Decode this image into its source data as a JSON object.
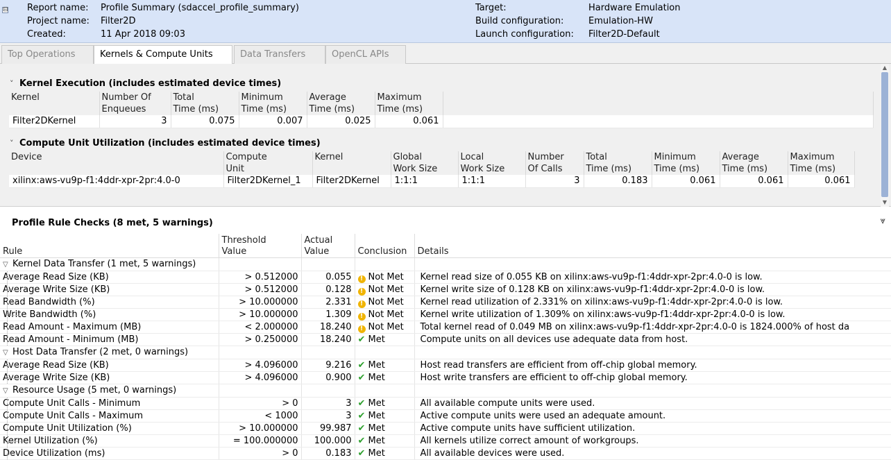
{
  "header": {
    "report_name_label": "Report name:",
    "report_name": "Profile Summary (sdaccel_profile_summary)",
    "project_name_label": "Project name:",
    "project_name": "Filter2D",
    "created_label": "Created:",
    "created": "11 Apr 2018 09:03",
    "target_label": "Target:",
    "target": "Hardware Emulation",
    "build_config_label": "Build configuration:",
    "build_config": "Emulation-HW",
    "launch_config_label": "Launch configuration:",
    "launch_config": "Filter2D-Default",
    "collapse_glyph": "⊟"
  },
  "tabs": [
    {
      "label": "Top Operations",
      "active": false
    },
    {
      "label": "Kernels & Compute Units",
      "active": true
    },
    {
      "label": "Data Transfers",
      "active": false
    },
    {
      "label": "OpenCL APIs",
      "active": false
    }
  ],
  "kernel_execution": {
    "title": "Kernel Execution (includes estimated device times)",
    "headers": [
      [
        "Kernel",
        ""
      ],
      [
        "Number Of",
        "Enqueues"
      ],
      [
        "Total",
        "Time (ms)"
      ],
      [
        "Minimum",
        "Time (ms)"
      ],
      [
        "Average",
        "Time (ms)"
      ],
      [
        "Maximum",
        "Time (ms)"
      ]
    ],
    "rows": [
      [
        "Filter2DKernel",
        "3",
        "0.075",
        "0.007",
        "0.025",
        "0.061"
      ]
    ]
  },
  "compute_unit": {
    "title": "Compute Unit Utilization (includes estimated device times)",
    "headers": [
      [
        "Device",
        ""
      ],
      [
        "Compute",
        "Unit"
      ],
      [
        "Kernel",
        ""
      ],
      [
        "Global",
        "Work Size"
      ],
      [
        "Local",
        "Work Size"
      ],
      [
        "Number",
        "Of Calls"
      ],
      [
        "Total",
        "Time (ms)"
      ],
      [
        "Minimum",
        "Time (ms)"
      ],
      [
        "Average",
        "Time (ms)"
      ],
      [
        "Maximum",
        "Time (ms)"
      ]
    ],
    "rows": [
      [
        "xilinx:aws-vu9p-f1:4ddr-xpr-2pr:4.0-0",
        "Filter2DKernel_1",
        "Filter2DKernel",
        "1:1:1",
        "1:1:1",
        "3",
        "0.183",
        "0.061",
        "0.061",
        "0.061"
      ]
    ]
  },
  "rules": {
    "title": "Profile Rule Checks (8 met, 5 warnings)",
    "headers": [
      [
        "Rule",
        ""
      ],
      [
        "Threshold",
        "Value"
      ],
      [
        "Actual",
        "Value"
      ],
      [
        "Conclusion",
        ""
      ],
      [
        "Details",
        ""
      ]
    ],
    "groups": [
      {
        "name": "Kernel Data Transfer (1 met, 5 warnings)",
        "rows": [
          [
            "Average Read Size (KB)",
            "> 0.512000",
            "0.055",
            "Not Met",
            "Kernel read size of 0.055 KB on xilinx:aws-vu9p-f1:4ddr-xpr-2pr:4.0-0 is low."
          ],
          [
            "Average Write Size (KB)",
            "> 0.512000",
            "0.128",
            "Not Met",
            "Kernel write size of 0.128 KB on xilinx:aws-vu9p-f1:4ddr-xpr-2pr:4.0-0 is low."
          ],
          [
            "Read Bandwidth (%)",
            "> 10.000000",
            "2.331",
            "Not Met",
            "Kernel read utilization of 2.331% on xilinx:aws-vu9p-f1:4ddr-xpr-2pr:4.0-0 is low."
          ],
          [
            "Write Bandwidth (%)",
            "> 10.000000",
            "1.309",
            "Not Met",
            "Kernel write utilization of 1.309% on xilinx:aws-vu9p-f1:4ddr-xpr-2pr:4.0-0 is low."
          ],
          [
            "Read Amount - Maximum (MB)",
            "< 2.000000",
            "18.240",
            "Not Met",
            "Total kernel read of 0.049 MB on xilinx:aws-vu9p-f1:4ddr-xpr-2pr:4.0-0 is 1824.000% of host da"
          ],
          [
            "Read Amount - Minimum (MB)",
            "> 0.250000",
            "18.240",
            "Met",
            "Compute units on all devices use adequate data from host."
          ]
        ]
      },
      {
        "name": "Host Data Transfer (2 met, 0 warnings)",
        "rows": [
          [
            "Average Read Size (KB)",
            "> 4.096000",
            "9.216",
            "Met",
            "Host read transfers are efficient from off-chip global memory."
          ],
          [
            "Average Write Size (KB)",
            "> 4.096000",
            "0.900",
            "Met",
            "Host write transfers are efficient to off-chip global memory."
          ]
        ]
      },
      {
        "name": "Resource Usage (5 met, 0 warnings)",
        "rows": [
          [
            "Compute Unit Calls - Minimum",
            "> 0",
            "3",
            "Met",
            "All available compute units were used."
          ],
          [
            "Compute Unit Calls - Maximum",
            "< 1000",
            "3",
            "Met",
            "Active compute units were used an adequate amount."
          ],
          [
            "Compute Unit Utilization (%)",
            "> 10.000000",
            "99.987",
            "Met",
            "Active compute units have sufficient utilization."
          ],
          [
            "Kernel Utilization (%)",
            "= 100.000000",
            "100.000",
            "Met",
            "All kernels utilize correct amount of workgroups."
          ],
          [
            "Device Utilization (ms)",
            "> 0",
            "0.183",
            "Met",
            "All available devices were used."
          ]
        ]
      }
    ]
  },
  "icons": {
    "section_chevron": "˅",
    "tree_expanded": "▽",
    "warning": "!",
    "check": "✔",
    "expand_all": "⩔",
    "scroll_up": "▲",
    "scroll_down": "▼"
  },
  "colors": {
    "header_bg": "#d8e4f8",
    "scrollbar_thumb": "#9cb2d6",
    "warning": "#f0b400",
    "met": "#2ea02e"
  }
}
